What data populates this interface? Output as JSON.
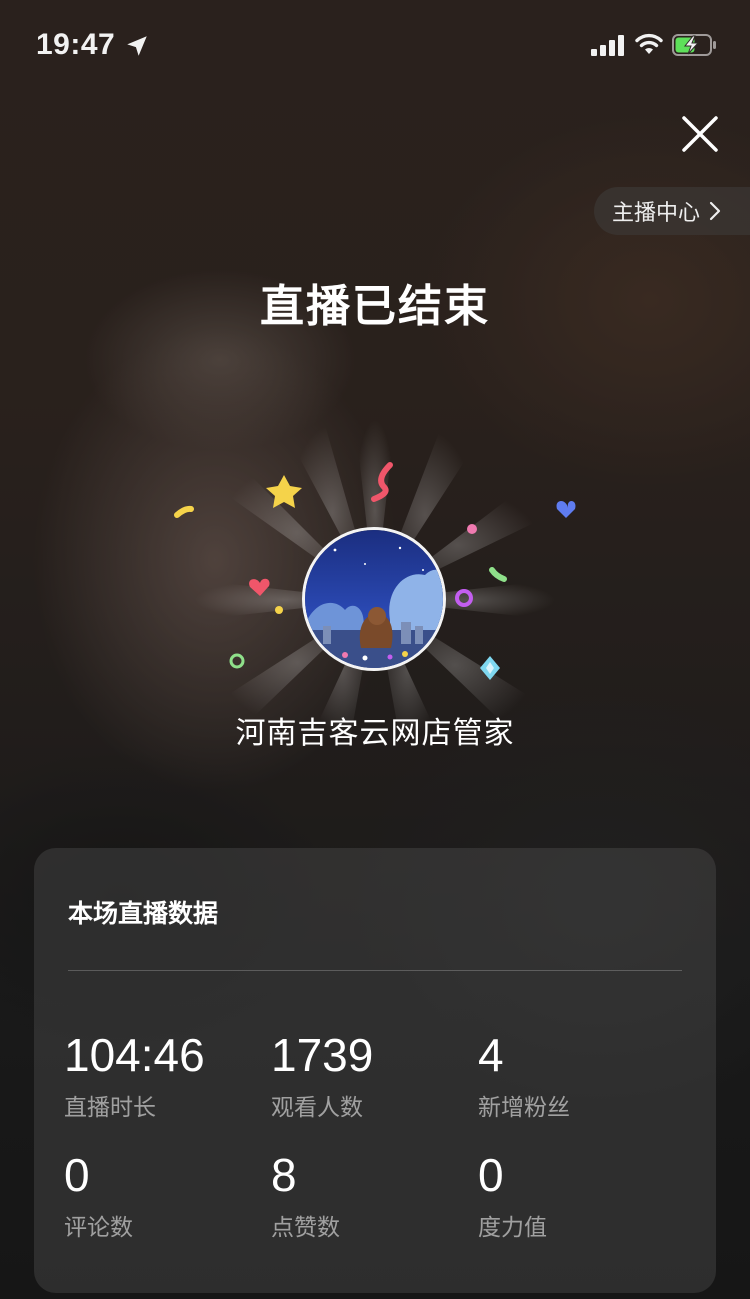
{
  "status_bar": {
    "time": "19:47",
    "icons": [
      "location-arrow-icon",
      "signal-icon",
      "wifi-icon",
      "battery-charging-icon"
    ]
  },
  "header": {
    "close_icon": "close-icon",
    "anchor_center_label": "主播中心",
    "anchor_center_icon": "chevron-right-icon"
  },
  "title": "直播已结束",
  "profile": {
    "name": "河南吉客云网店管家",
    "avatar_icon": "avatar-night-sky-image"
  },
  "stats_card": {
    "title": "本场直播数据",
    "items": [
      {
        "value": "104:46",
        "label": "直播时长"
      },
      {
        "value": "1739",
        "label": "观看人数"
      },
      {
        "value": "4",
        "label": "新增粉丝"
      },
      {
        "value": "0",
        "label": "评论数"
      },
      {
        "value": "8",
        "label": "点赞数"
      },
      {
        "value": "0",
        "label": "度力值"
      }
    ]
  },
  "colors": {
    "confetti_yellow": "#f5d34a",
    "confetti_red": "#f0566a",
    "confetti_pink": "#f07ab0",
    "confetti_blue": "#5f7cf0",
    "confetti_green": "#8fe08a",
    "confetti_purple": "#c35ef0",
    "confetti_cyan": "#7fd8f0"
  }
}
